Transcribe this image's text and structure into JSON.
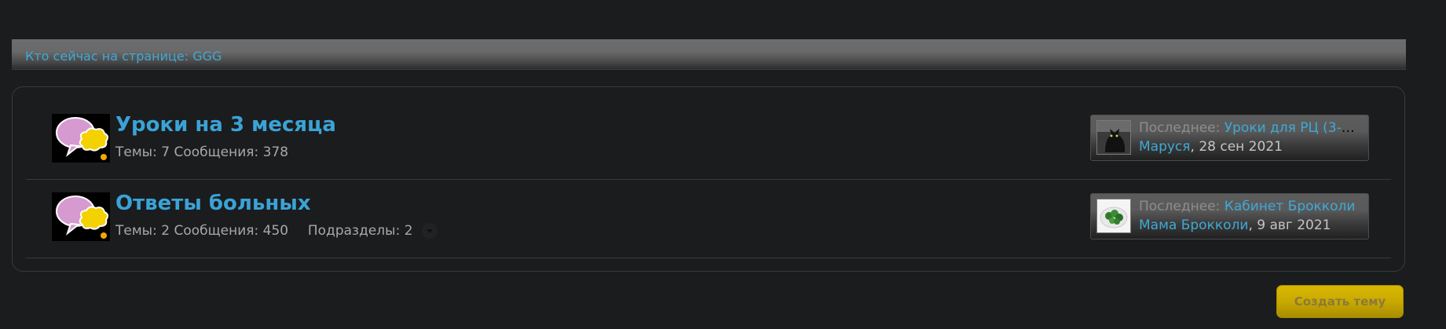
{
  "who_bar": {
    "text": "Кто сейчас на странице: GGG"
  },
  "forums": [
    {
      "title": "Уроки на 3 месяца",
      "stats": {
        "topics_label": "Темы:",
        "topics": "7",
        "posts_label": "Сообщения:",
        "posts": "378"
      },
      "icon": "speech-bubbles-icon",
      "last_post": {
        "label": "Последнее:",
        "thread": "Уроки для РЦ (3-й се...",
        "user": "Маруся",
        "date": ", 28 сен 2021",
        "avatar": "cat-avatar"
      }
    },
    {
      "title": "Ответы больных",
      "stats": {
        "topics_label": "Темы:",
        "topics": "2",
        "posts_label": "Сообщения:",
        "posts": "450",
        "subforums_label": "Подразделы:",
        "subforums": "2"
      },
      "icon": "speech-bubbles-icon",
      "last_post": {
        "label": "Последнее:",
        "thread": "Кабинет Брокколи",
        "user": "Мама Брокколи",
        "date": ", 9 авг 2021",
        "avatar": "broccoli-avatar"
      }
    }
  ],
  "create_thread_button": {
    "label": "Создать тему"
  },
  "colors": {
    "link": "#3fa9d6",
    "background": "#1b1c1e",
    "button": "#c9a900"
  }
}
